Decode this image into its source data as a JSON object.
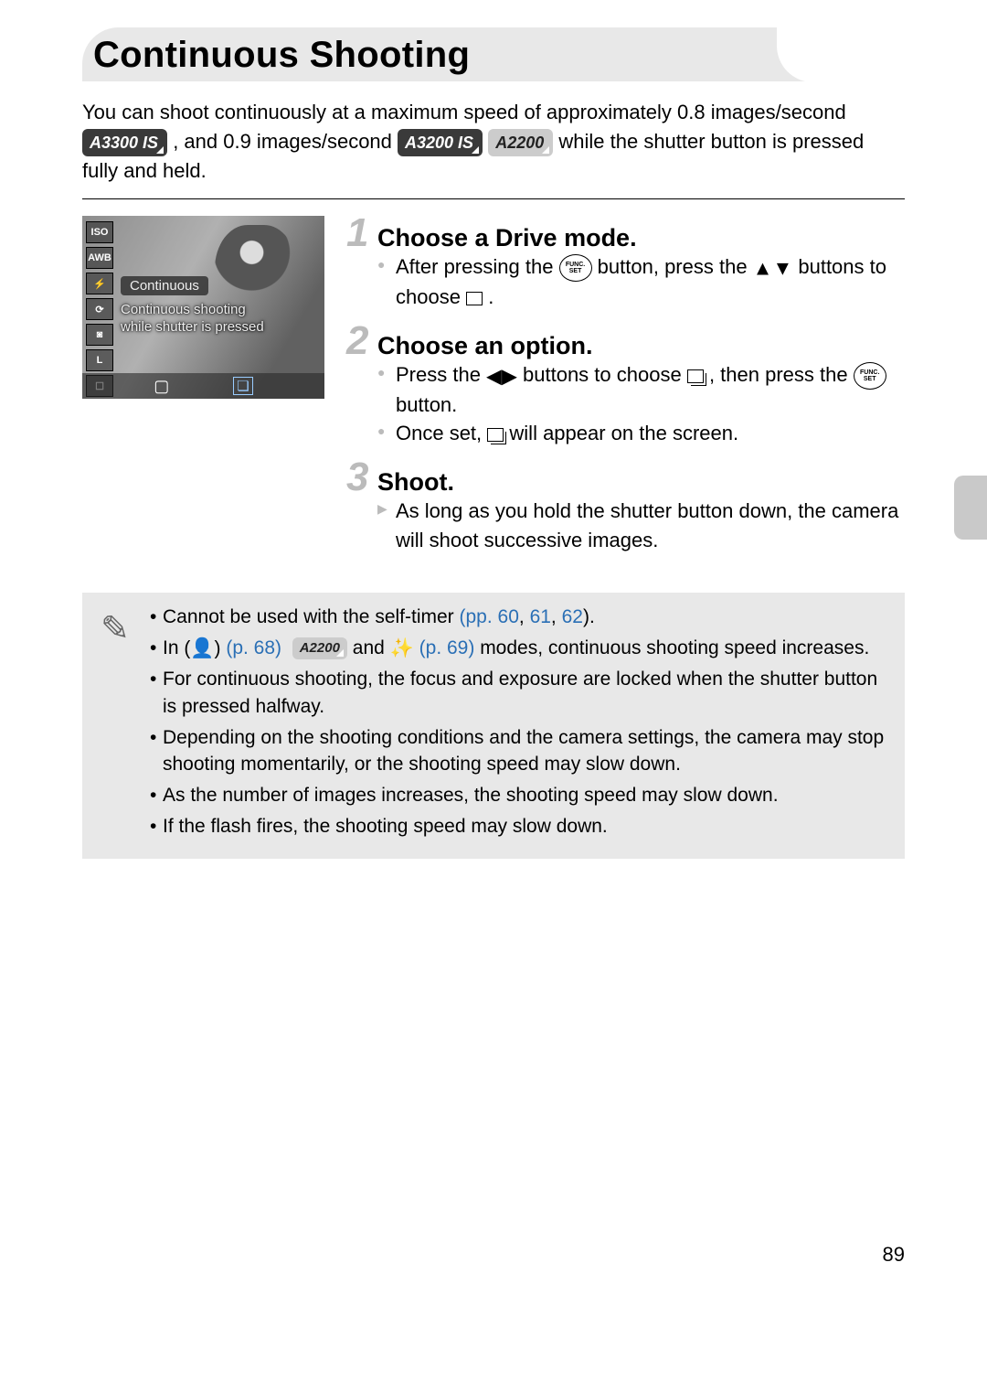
{
  "title": "Continuous Shooting",
  "intro": {
    "line1": "You can shoot continuously at a maximum speed of approximately 0.8 ",
    "line2a": "images/second ",
    "line2b": ", and 0.9 images/second ",
    "line2c": " while the shutter button is pressed fully and held."
  },
  "badges": {
    "a3300": "A3300 IS",
    "a3200": "A3200 IS",
    "a2200": "A2200"
  },
  "lcd": {
    "tooltip": "Continuous",
    "subtip": "Continuous shooting\nwhile shutter is pressed",
    "icons": [
      "ISO",
      "AWB",
      "⚡",
      "⟳",
      "◙",
      "L",
      "☐"
    ]
  },
  "steps": [
    {
      "title": "Choose a Drive mode.",
      "lines": [
        {
          "type": "bullet",
          "pre": "After pressing the ",
          "mid": " button, press the ",
          "post": " buttons to choose ",
          "end": "."
        }
      ]
    },
    {
      "title": "Choose an option.",
      "lines": [
        {
          "type": "bullet",
          "pre": "Press the ",
          "mid": " buttons to choose ",
          "mid2": ", then press the ",
          "post": " button."
        },
        {
          "type": "bullet",
          "pre": "Once set, ",
          "post": " will appear on the screen."
        }
      ]
    },
    {
      "title": "Shoot.",
      "lines": [
        {
          "type": "arrow",
          "text": "As long as you hold the shutter button down, the camera will shoot successive images."
        }
      ]
    }
  ],
  "func_label": {
    "top": "FUNC.",
    "bot": "SET"
  },
  "notes": {
    "n1a": "Cannot be used with the self-timer ",
    "n1b": "(pp. 60",
    "n1c": ", ",
    "n1d": "61",
    "n1e": ", ",
    "n1f": "62",
    "n1g": ").",
    "n2a": "In ",
    "n2b": " (p. 68)",
    "n2c": " and ",
    "n2d": " (p. 69)",
    "n2e": " modes, continuous shooting speed increases.",
    "n3": "For continuous shooting, the focus and exposure are locked when the shutter button is pressed halfway.",
    "n4": "Depending on the shooting conditions and the camera settings, the camera may stop shooting momentarily, or the shooting speed may slow down.",
    "n5": "As the number of images increases, the shooting speed may slow down.",
    "n6": "If the flash fires, the shooting speed may slow down."
  },
  "page_number": "89"
}
